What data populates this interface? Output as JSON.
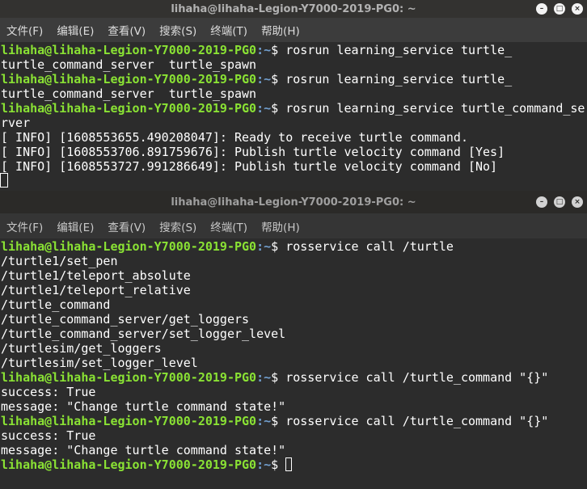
{
  "terminal1": {
    "title": "lihaha@lihaha-Legion-Y7000-2019-PG0: ~",
    "menu": [
      "文件(F)",
      "编辑(E)",
      "查看(V)",
      "搜索(S)",
      "终端(T)",
      "帮助(H)"
    ],
    "lines": [
      {
        "prompt_user": "lihaha@lihaha-Legion-Y7000-2019-PG0",
        "prompt_path": ":~",
        "text": "$ rosrun learning_service turtle_"
      },
      {
        "text": "turtle_command_server  turtle_spawn"
      },
      {
        "prompt_user": "lihaha@lihaha-Legion-Y7000-2019-PG0",
        "prompt_path": ":~",
        "text": "$ rosrun learning_service turtle_"
      },
      {
        "text": "turtle_command_server  turtle_spawn"
      },
      {
        "prompt_user": "lihaha@lihaha-Legion-Y7000-2019-PG0",
        "prompt_path": ":~",
        "text": "$ rosrun learning_service turtle_command_se"
      },
      {
        "text": "rver"
      },
      {
        "text": "[ INFO] [1608553655.490208047]: Ready to receive turtle command."
      },
      {
        "text": "[ INFO] [1608553706.891759676]: Publish turtle velocity command [Yes]"
      },
      {
        "text": "[ INFO] [1608553727.991286649]: Publish turtle velocity command [No]"
      }
    ]
  },
  "terminal2": {
    "title": "lihaha@lihaha-Legion-Y7000-2019-PG0: ~",
    "menu": [
      "文件(F)",
      "编辑(E)",
      "查看(V)",
      "搜索(S)",
      "终端(T)",
      "帮助(H)"
    ],
    "lines": [
      {
        "prompt_user": "lihaha@lihaha-Legion-Y7000-2019-PG0",
        "prompt_path": ":~",
        "text": "$ rosservice call /turtle"
      },
      {
        "text": "/turtle1/set_pen"
      },
      {
        "text": "/turtle1/teleport_absolute"
      },
      {
        "text": "/turtle1/teleport_relative"
      },
      {
        "text": "/turtle_command"
      },
      {
        "text": "/turtle_command_server/get_loggers"
      },
      {
        "text": "/turtle_command_server/set_logger_level"
      },
      {
        "text": "/turtlesim/get_loggers"
      },
      {
        "text": "/turtlesim/set_logger_level"
      },
      {
        "prompt_user": "lihaha@lihaha-Legion-Y7000-2019-PG0",
        "prompt_path": ":~",
        "text": "$ rosservice call /turtle_command \"{}\""
      },
      {
        "text": "success: True"
      },
      {
        "text": "message: \"Change turtle command state!\""
      },
      {
        "prompt_user": "lihaha@lihaha-Legion-Y7000-2019-PG0",
        "prompt_path": ":~",
        "text": "$ rosservice call /turtle_command \"{}\""
      },
      {
        "text": "success: True"
      },
      {
        "text": "message: \"Change turtle command state!\""
      },
      {
        "prompt_user": "lihaha@lihaha-Legion-Y7000-2019-PG0",
        "prompt_path": ":~",
        "text": "$ ",
        "cursor": true
      }
    ]
  },
  "window_buttons": {
    "minimize": "–",
    "maximize": "□",
    "close": "×"
  },
  "colors": {
    "prompt_user": "#8ae234",
    "prompt_path": "#729fcf",
    "text": "#ffffff",
    "background": "#2c2c2c"
  }
}
